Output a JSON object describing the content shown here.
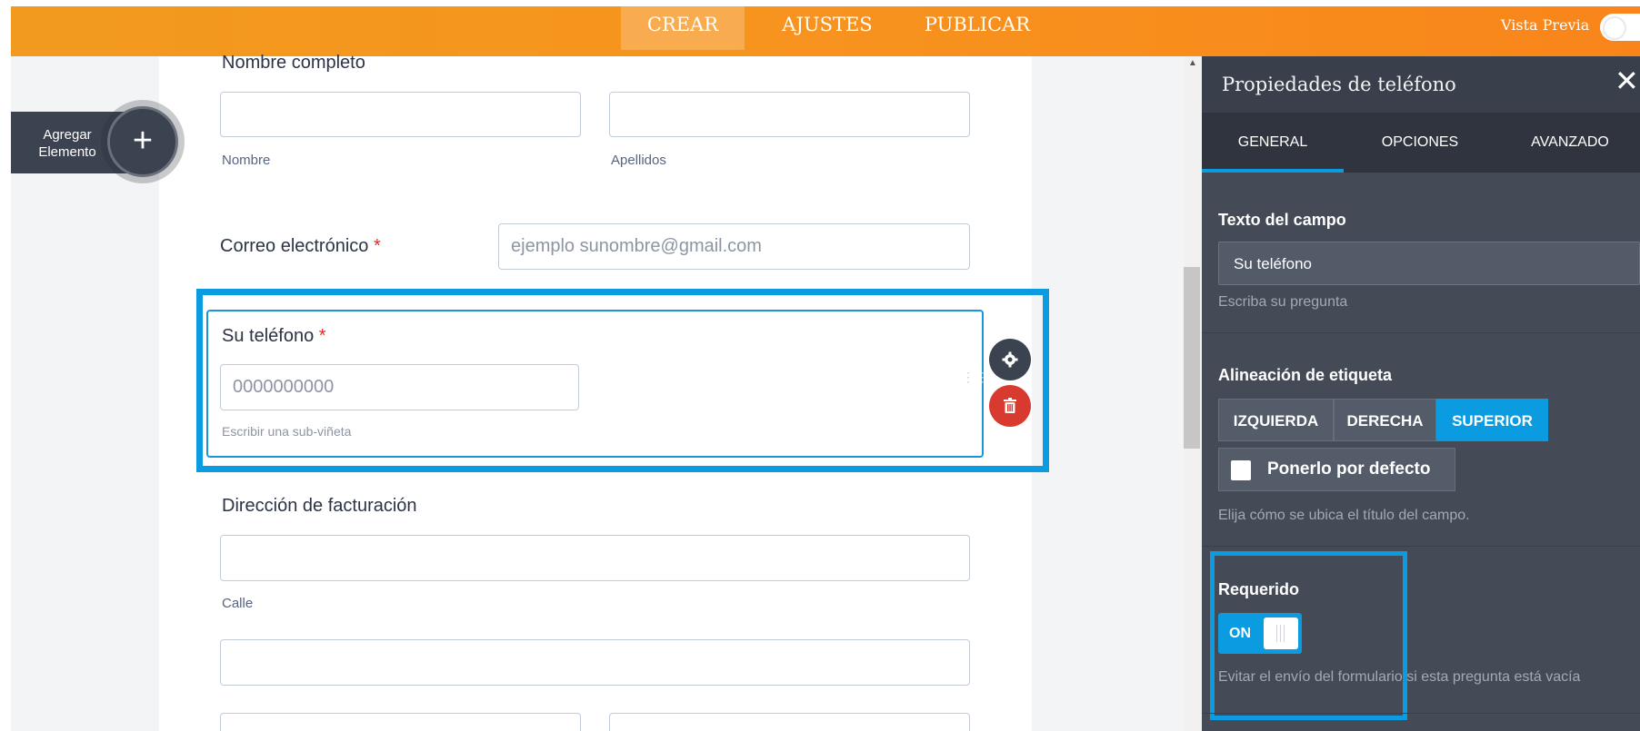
{
  "topbar": {
    "tabs": [
      "CREAR",
      "AJUSTES",
      "PUBLICAR"
    ],
    "preview_label": "Vista Previa"
  },
  "builder": {
    "add_element_label": "Agregar Elemento"
  },
  "form": {
    "full_name": {
      "label": "Nombre completo",
      "first_sub": "Nombre",
      "last_sub": "Apellidos"
    },
    "email": {
      "label": "Correo electrónico",
      "required_mark": "*",
      "placeholder": "ejemplo sunombre@gmail.com"
    },
    "phone": {
      "label": "Su teléfono",
      "required_mark": "*",
      "placeholder": "0000000000",
      "sublabel": "Escribir una sub-viñeta"
    },
    "billing": {
      "label": "Dirección de facturación",
      "street_sub": "Calle"
    }
  },
  "panel": {
    "title": "Propiedades de teléfono",
    "tabs": [
      "GENERAL",
      "OPCIONES",
      "AVANZADO"
    ],
    "field_text": {
      "title": "Texto del campo",
      "value": "Su teléfono",
      "hint": "Escriba su pregunta"
    },
    "label_alignment": {
      "title": "Alineación de etiqueta",
      "options": [
        "IZQUIERDA",
        "DERECHA",
        "SUPERIOR"
      ],
      "selected": "SUPERIOR",
      "default_label": "Ponerlo por defecto",
      "hint": "Elija cómo se ubica el título del campo."
    },
    "required": {
      "title": "Requerido",
      "toggle_label": "ON",
      "hint": "Evitar el envío del formulario si esta pregunta está vacía"
    }
  },
  "colors": {
    "topbar": "#f7931e",
    "accent": "#0a9be0",
    "panel_bg": "#444b57",
    "delete": "#d93a30"
  }
}
